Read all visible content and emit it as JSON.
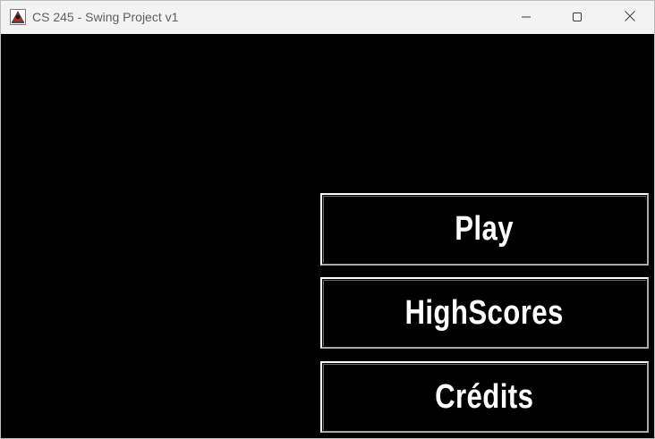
{
  "window": {
    "title": "CS 245 - Swing Project v1",
    "app_icon": "java-duke-icon",
    "controls": {
      "minimize_icon": "minimize-icon",
      "maximize_icon": "maximize-icon",
      "close_icon": "close-icon"
    }
  },
  "menu": {
    "play_label": "Play",
    "highscores_label": "HighScores",
    "credits_label": "Crédits"
  },
  "colors": {
    "titlebar_bg": "#f3f3f3",
    "title_text": "#5f5f5f",
    "content_bg": "#000000",
    "button_text": "#ffffff",
    "button_border_light": "#ffffff",
    "button_border_shadow": "#a8a8a8"
  }
}
